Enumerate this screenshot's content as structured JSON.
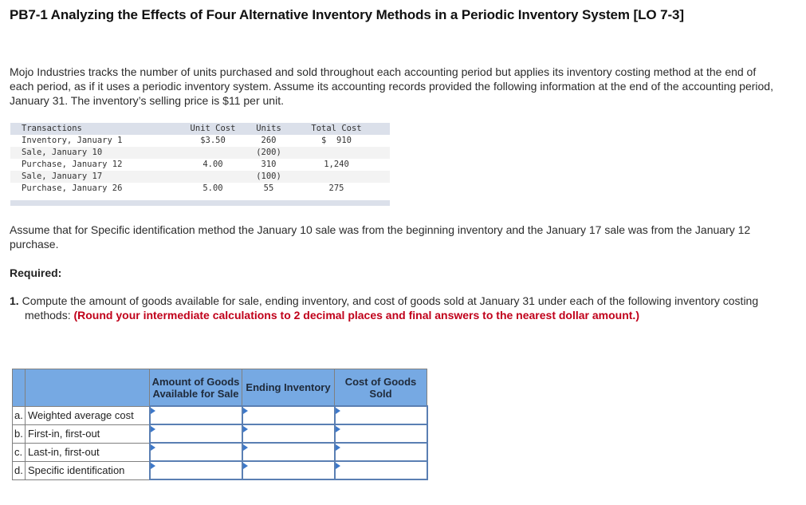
{
  "title": "PB7-1 Analyzing the Effects of Four Alternative Inventory Methods in a Periodic Inventory System [LO 7-3]",
  "intro": "Mojo Industries tracks the number of units purchased and sold throughout each accounting period but applies its inventory costing method at the end of each period, as if it uses a periodic inventory system. Assume its accounting records provided the following information at the end of the accounting period, January 31. The inventory’s selling price is $11 per unit.",
  "transactions": {
    "headers": [
      "Transactions",
      "Unit Cost",
      "Units",
      "Total Cost"
    ],
    "rows": [
      {
        "name": "Inventory, January 1",
        "unit_cost": "$3.50",
        "units": "260",
        "total_cost": "$  910"
      },
      {
        "name": "Sale, January 10",
        "unit_cost": "",
        "units": "(200)",
        "total_cost": ""
      },
      {
        "name": "Purchase, January 12",
        "unit_cost": "4.00",
        "units": "310",
        "total_cost": "1,240"
      },
      {
        "name": "Sale, January 17",
        "unit_cost": "",
        "units": "(100)",
        "total_cost": ""
      },
      {
        "name": "Purchase, January 26",
        "unit_cost": "5.00",
        "units": "55",
        "total_cost": "275"
      }
    ]
  },
  "assumption": "Assume that for Specific identification method the January 10 sale was from the beginning inventory and the January 17 sale was from the January 12 purchase.",
  "required_label": "Required:",
  "question": {
    "number": "1.",
    "text": "Compute the amount of goods available for sale, ending inventory, and cost of goods sold at January 31 under each of the following inventory costing methods: ",
    "instruction": "(Round your intermediate calculations to 2 decimal places and final answers to the nearest dollar amount.)"
  },
  "answer_table": {
    "headers": [
      "Amount of Goods Available for Sale",
      "Ending Inventory",
      "Cost of Goods Sold"
    ],
    "rows": [
      {
        "letter": "a.",
        "label": "Weighted average cost",
        "values": [
          "",
          "",
          ""
        ]
      },
      {
        "letter": "b.",
        "label": "First-in, first-out",
        "values": [
          "",
          "",
          ""
        ]
      },
      {
        "letter": "c.",
        "label": "Last-in, first-out",
        "values": [
          "",
          "",
          ""
        ]
      },
      {
        "letter": "d.",
        "label": "Specific identification",
        "values": [
          "",
          "",
          ""
        ]
      }
    ]
  },
  "colors": {
    "header_blue": "#76a9e3",
    "input_border": "#5a7fb3",
    "instruction_red": "#c0001a",
    "tx_header_band": "#dbe0ea"
  }
}
